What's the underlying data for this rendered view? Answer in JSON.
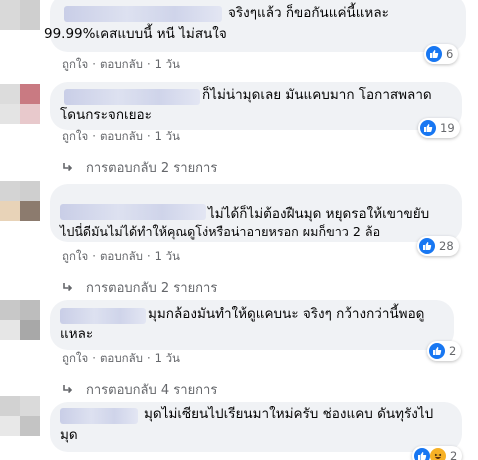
{
  "comments": [
    {
      "lines": [
        "จริงๆแล้ว ก็ขอกันแค่นี้แหละ",
        "99.99%เคสแบบนี้ หนี ไม่สนใจ"
      ],
      "reaction_count": "6",
      "like_label": "ถูกใจ",
      "reply_label": "ตอบกลับ",
      "time": "1 วัน"
    },
    {
      "lines": [
        "ก็ไม่น่ามุดเลย มันแคบมาก โอกาสพลาด",
        "โดนกระจกเยอะ"
      ],
      "reaction_count": "19",
      "like_label": "ถูกใจ",
      "reply_label": "ตอบกลับ",
      "time": "1 วัน",
      "replies_label": "การตอบกลับ 2 รายการ"
    },
    {
      "lines": [
        "ไม่ได้ก็ไม่ต้องฝืนมุด หยุดรอให้เขาขยับ",
        "ไปนี่ดีมันไม่ได้ทำให้คุณดูโง่หรือน่าอายหรอก ผมก็ขาว 2 ล้อ"
      ],
      "reaction_count": "28",
      "like_label": "ถูกใจ",
      "reply_label": "ตอบกลับ",
      "time": "1 วัน",
      "replies_label": "การตอบกลับ 2 รายการ"
    },
    {
      "lines": [
        "มุมกล้องมันทำให้ดูแคบนะ จริงๆ กว้างกว่านี้พอดู",
        "แหละ"
      ],
      "reaction_count": "2",
      "like_label": "ถูกใจ",
      "reply_label": "ตอบกลับ",
      "time": "1 วัน",
      "replies_label": "การตอบกลับ 4 รายการ"
    },
    {
      "lines": [
        "มุดไม่เซียนไปเรียนมาใหม่ครับ ช่องแคบ ดันทุรังไป",
        "มุด"
      ],
      "reaction_count": "2"
    }
  ],
  "colors": {
    "bubble": "#f0f2f5",
    "meta_text": "#65676b",
    "like_blue": "#1877f2",
    "haha_yellow": "#f7b125"
  },
  "icons": {
    "like": "like-icon",
    "haha": "haha-icon",
    "reply_arrow": "reply-arrow-icon"
  }
}
